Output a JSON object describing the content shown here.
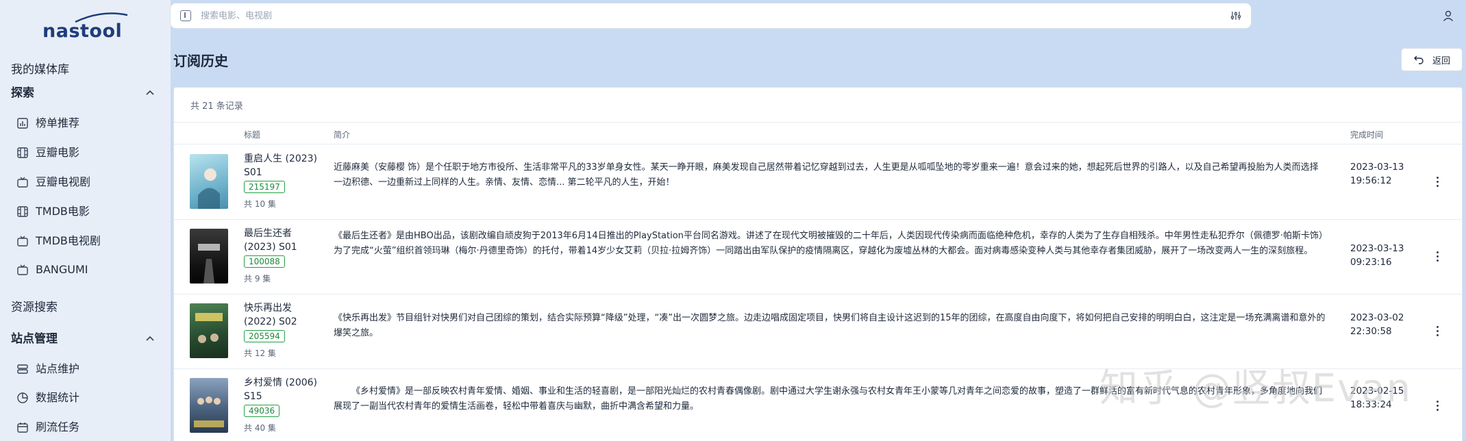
{
  "app": {
    "logo": "nastool"
  },
  "sidebar": {
    "library": "我的媒体库",
    "explore": {
      "label": "探索",
      "items": [
        {
          "label": "榜单推荐",
          "icon": "chart-icon"
        },
        {
          "label": "豆瓣电影",
          "icon": "film-icon"
        },
        {
          "label": "豆瓣电视剧",
          "icon": "tv-icon"
        },
        {
          "label": "TMDB电影",
          "icon": "film-icon"
        },
        {
          "label": "TMDB电视剧",
          "icon": "tv-icon"
        },
        {
          "label": "BANGUMI",
          "icon": "tv-icon"
        }
      ]
    },
    "resource_search": "资源搜索",
    "site": {
      "label": "站点管理",
      "items": [
        {
          "label": "站点维护",
          "icon": "server-icon"
        },
        {
          "label": "数据统计",
          "icon": "pie-chart-icon"
        },
        {
          "label": "刷流任务",
          "icon": "calendar-icon"
        }
      ]
    }
  },
  "search": {
    "placeholder": "搜索电影、电视剧",
    "value": ""
  },
  "page": {
    "title": "订阅历史",
    "back_label": "返回"
  },
  "table": {
    "count_label": "共 21 条记录",
    "columns": {
      "title": "标题",
      "overview": "简介",
      "completed": "完成时间"
    },
    "rows": [
      {
        "title": "重启人生 (2023) S01",
        "tmdb_id": "215197",
        "episodes": "共 10 集",
        "overview": "近藤麻美（安藤樱 饰）是个任职于地方市役所、生活非常平凡的33岁单身女性。某天一睁开眼，麻美发现自己居然带着记忆穿越到过去，人生更是从呱呱坠地的零岁重来一遍！意会过来的她，想起死后世界的引路人，以及自己希望再投胎为人类而选择一边积德、一边重新过上同样的人生。亲情、友情、恋情... 第二轮平凡的人生，开始！",
        "date": "2023-03-13",
        "time": "19:56:12",
        "poster_colors": [
          "#9fd3e4",
          "#5aa4c0"
        ]
      },
      {
        "title": "最后生还者 (2023) S01",
        "tmdb_id": "100088",
        "episodes": "共 9 集",
        "overview": "《最后生还者》是由HBO出品，该剧改编自顽皮狗于2013年6月14日推出的PlayStation平台同名游戏。讲述了在现代文明被摧毁的二十年后，人类因现代传染病而面临绝种危机，幸存的人类为了生存自相残杀。中年男性走私犯乔尔（佩德罗·帕斯卡饰）为了完成“火萤”组织首领玛琳（梅尔·丹德里奇饰）的托付，带着14岁少女艾莉（贝拉·拉姆齐饰）一同踏出由军队保护的疫情隔离区，穿越化为废墟丛林的大都会。面对病毒感染变种人类与其他幸存者集团威胁，展开了一场改变两人一生的深刻旅程。",
        "date": "2023-03-13",
        "time": "09:23:16",
        "poster_colors": [
          "#2a2a2a",
          "#0d0d0d"
        ]
      },
      {
        "title": "快乐再出发 (2022) S02",
        "tmdb_id": "205594",
        "episodes": "共 12 集",
        "overview": "《快乐再出发》节目组针对快男们对自己团综的策划，结合实际预算“降级”处理，“凑”出一次圆梦之旅。边走边唱成固定项目，快男们将自主设计这迟到的15年的团综，在高度自由向度下，将如何把自己安排的明明白白，这注定是一场充满离谱和意外的爆笑之旅。",
        "date": "2023-03-02",
        "time": "22:30:58",
        "poster_colors": [
          "#3f6e44",
          "#1d3b24"
        ]
      },
      {
        "title": "乡村爱情 (2006) S15",
        "tmdb_id": "49036",
        "episodes": "共 40 集",
        "overview": "《乡村爱情》是一部反映农村青年爱情、婚姻、事业和生活的轻喜剧，是一部阳光灿烂的农村青春偶像剧。剧中通过大学生谢永强与农村女青年王小蒙等几对青年之间恋爱的故事，塑造了一群鲜活的富有新时代气息的农村青年形象，多角度地向我们展现了一副当代农村青年的爱情生活画卷，轻松中带着喜庆与幽默，曲折中满含希望和力量。",
        "date": "2023-02-15",
        "time": "18:33:24",
        "poster_colors": [
          "#5f7894",
          "#2e3f56"
        ]
      }
    ]
  },
  "watermark": "知乎 @竖叔Evan"
}
